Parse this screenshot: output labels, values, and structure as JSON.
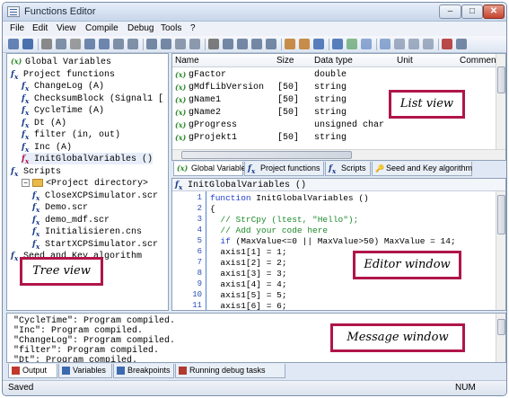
{
  "window": {
    "title": "Functions Editor",
    "min_label": "–",
    "max_label": "□",
    "close_label": "✕"
  },
  "menu": [
    "File",
    "Edit",
    "View",
    "Compile",
    "Debug",
    "Tools",
    "?"
  ],
  "toolbar": {
    "icons": [
      "menu-grip-icon",
      "save-icon",
      "cut-icon",
      "copy-icon",
      "paste-icon",
      "undo-icon",
      "redo-icon",
      "find-icon",
      "replace-icon",
      "copy-line-icon",
      "copy-block-icon",
      "comment-icon",
      "uncomment-icon",
      "font-size-icon",
      "indent-icon",
      "outdent-icon",
      "list-icon",
      "table-icon",
      "compile-icon",
      "compile-all-icon",
      "view-icon",
      "view-split-icon",
      "run-icon",
      "pause-icon",
      "stop-icon",
      "step-into-icon",
      "step-over-icon",
      "step-out-icon",
      "breakpoint-icon",
      "watch-icon"
    ]
  },
  "tree": {
    "items": [
      {
        "icon": "variable",
        "label": "Global Variables",
        "level": 0
      },
      {
        "icon": "function",
        "label": "Project functions",
        "level": 0
      },
      {
        "icon": "function",
        "label": "ChangeLog (A)",
        "level": 1
      },
      {
        "icon": "function",
        "label": "ChecksumBlock (Signal1 [",
        "level": 1
      },
      {
        "icon": "function",
        "label": "CycleTime (A)",
        "level": 1
      },
      {
        "icon": "function",
        "label": "Dt (A)",
        "level": 1
      },
      {
        "icon": "function",
        "label": "filter (in, out)",
        "level": 1
      },
      {
        "icon": "function",
        "label": "Inc (A)",
        "level": 1
      },
      {
        "icon": "function-selected",
        "label": "InitGlobalVariables ()",
        "level": 1
      },
      {
        "icon": "function",
        "label": "Scripts",
        "level": 0
      },
      {
        "icon": "folder",
        "label": "<Project directory>",
        "level": 1
      },
      {
        "icon": "function",
        "label": "CloseXCPSimulator.scr",
        "level": 2
      },
      {
        "icon": "function",
        "label": "Demo.scr",
        "level": 2
      },
      {
        "icon": "function",
        "label": "demo_mdf.scr",
        "level": 2
      },
      {
        "icon": "function",
        "label": "Initialisieren.cns",
        "level": 2
      },
      {
        "icon": "function",
        "label": "StartXCPSimulator.scr",
        "level": 2
      },
      {
        "icon": "function",
        "label": "Seed and Key algorithm",
        "level": 0
      }
    ],
    "toggle_collapse": "−",
    "toggle_expand": "+"
  },
  "list": {
    "columns": [
      "Name",
      "Size",
      "Data type",
      "Unit",
      "Comment"
    ],
    "rows": [
      {
        "name": "gFactor",
        "size": "",
        "type": "double"
      },
      {
        "name": "gMdfLibVersion",
        "size": "[50]",
        "type": "string"
      },
      {
        "name": "gName1",
        "size": "[50]",
        "type": "string"
      },
      {
        "name": "gName2",
        "size": "[50]",
        "type": "string"
      },
      {
        "name": "gProgress",
        "size": "",
        "type": "unsigned char"
      },
      {
        "name": "gProjekt1",
        "size": "[50]",
        "type": "string"
      }
    ]
  },
  "center_tabs": [
    {
      "label": "Global Variables",
      "icon": "variable",
      "active": true
    },
    {
      "label": "Project functions",
      "icon": "function",
      "active": false
    },
    {
      "label": "Scripts",
      "icon": "function",
      "active": false
    },
    {
      "label": "Seed and Key algorithm",
      "icon": "key",
      "active": false
    }
  ],
  "editor": {
    "title": "InitGlobalVariables ()",
    "line_numbers": [
      "1",
      "2",
      "3",
      "4",
      "5",
      "6",
      "7",
      "8",
      "9",
      "10",
      "11"
    ],
    "lines": [
      {
        "kw": "function",
        "rest": " InitGlobalVariables ()"
      },
      {
        "rest": "{"
      },
      {
        "cm": "  // StrCpy (ltest, \"Hello\");"
      },
      {
        "cm": "  // Add your code here"
      },
      {
        "kw": "  if",
        "rest": " (MaxValue<=0 || MaxValue>50) MaxValue = 14;"
      },
      {
        "rest": "  axis1[1] = 1;"
      },
      {
        "rest": "  axis1[2] = 2;"
      },
      {
        "rest": "  axis1[3] = 3;"
      },
      {
        "rest": "  axis1[4] = 4;"
      },
      {
        "rest": "  axis1[5] = 5;"
      },
      {
        "rest": "  axis1[6] = 6;"
      }
    ]
  },
  "messages": [
    "\"CycleTime\": Program compiled.",
    "\"Inc\": Program compiled.",
    "\"ChangeLog\": Program compiled.",
    "\"filter\": Program compiled.",
    "\"Dt\": Program compiled."
  ],
  "bottom_tabs": [
    {
      "label": "Output",
      "icon": "output",
      "active": true
    },
    {
      "label": "Variables",
      "icon": "variables",
      "active": false
    },
    {
      "label": "Breakpoints",
      "icon": "breakpoints",
      "active": false
    },
    {
      "label": "Running debug tasks",
      "icon": "debug-tasks",
      "active": false
    }
  ],
  "status": {
    "left": "Saved",
    "right": "NUM"
  },
  "callouts": {
    "list": "List view",
    "tree": "Tree view",
    "editor": "Editor window",
    "message": "Message window"
  },
  "colors": {
    "callout_border": "#b0154a",
    "accent": "#1b3d8c",
    "variable_green": "#2a8a2a"
  }
}
